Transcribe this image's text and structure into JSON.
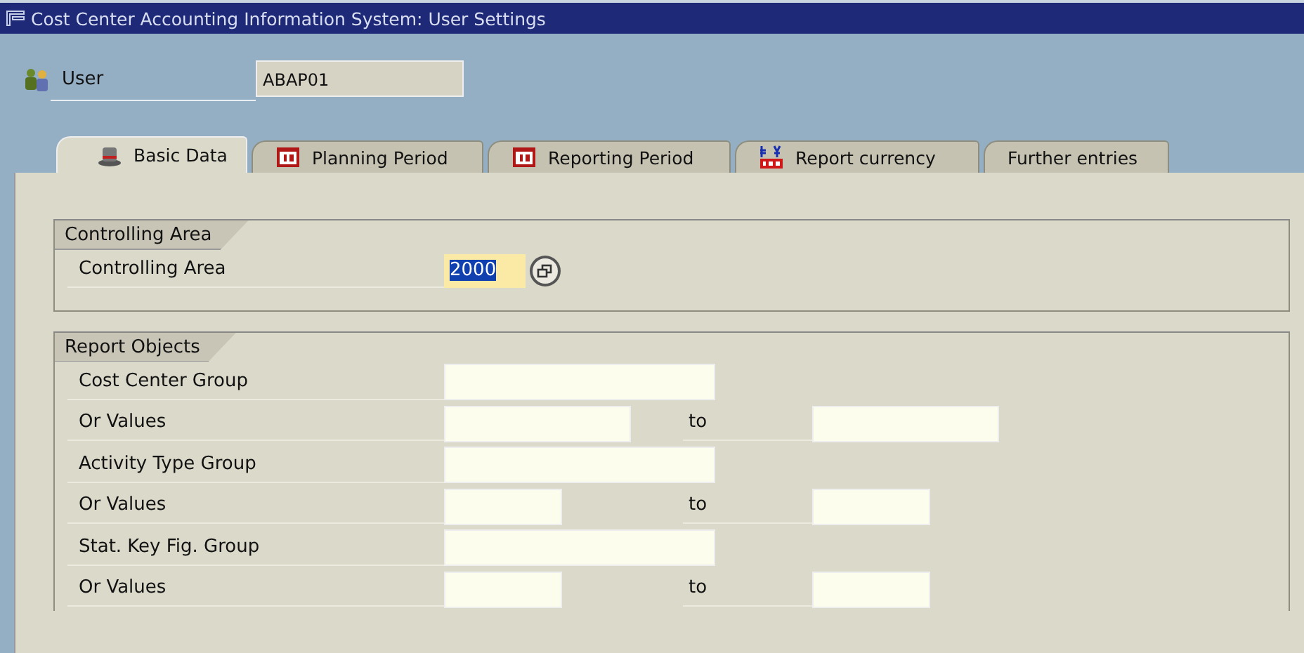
{
  "window": {
    "title": "Cost Center Accounting Information System: User Settings"
  },
  "user": {
    "label": "User",
    "value": "ABAP01"
  },
  "tabs": [
    {
      "label": "Basic Data",
      "kind": "hat",
      "selected": true
    },
    {
      "label": "Planning Period",
      "kind": "calendar",
      "selected": false
    },
    {
      "label": "Reporting Period",
      "kind": "calendar",
      "selected": false
    },
    {
      "label": "Report currency",
      "kind": "currency",
      "selected": false
    },
    {
      "label": "Further entries",
      "kind": "plain",
      "selected": false
    }
  ],
  "controlling_area": {
    "title": "Controlling Area",
    "label": "Controlling Area",
    "value": "2000",
    "selected": true
  },
  "report_objects": {
    "title": "Report Objects",
    "rows": [
      {
        "kind": "group",
        "label": "Cost Center Group"
      },
      {
        "kind": "range-long",
        "label": "Or Values",
        "to": "to"
      },
      {
        "kind": "group",
        "label": "Activity Type Group"
      },
      {
        "kind": "range-short",
        "label": "Or Values",
        "to": "to"
      },
      {
        "kind": "group",
        "label": "Stat. Key Fig. Group"
      },
      {
        "kind": "range-short",
        "label": "Or Values",
        "to": "to"
      }
    ]
  }
}
